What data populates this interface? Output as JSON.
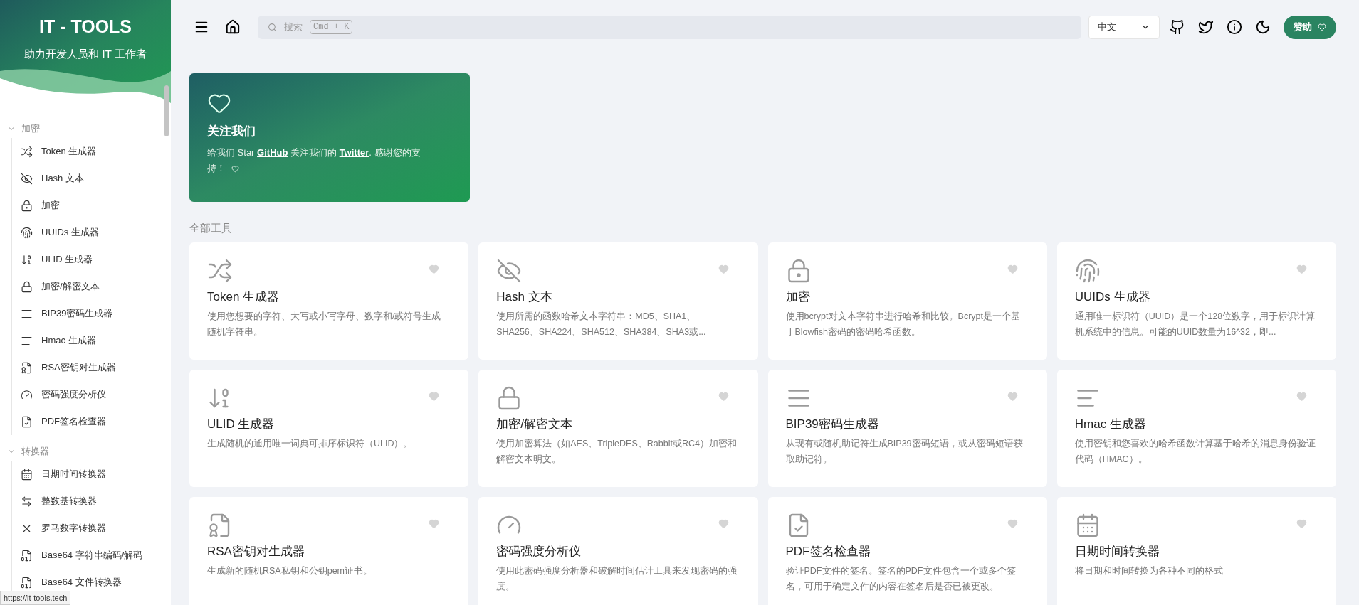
{
  "sidebar": {
    "title": "IT - TOOLS",
    "subtitle": "助力开发人员和 IT 工作者",
    "groups": [
      {
        "label": "加密",
        "expanded": true,
        "items": [
          {
            "kind": "shuffle",
            "label": "Token 生成器"
          },
          {
            "kind": "eyeoff",
            "label": "Hash 文本"
          },
          {
            "kind": "lockbox",
            "label": "加密"
          },
          {
            "kind": "fingerprint",
            "label": "UUIDs 生成器"
          },
          {
            "kind": "sortdigits",
            "label": "ULID 生成器"
          },
          {
            "kind": "lock",
            "label": "加密/解密文本"
          },
          {
            "kind": "lines",
            "label": "BIP39密码生成器"
          },
          {
            "kind": "shortlines",
            "label": "Hmac 生成器"
          },
          {
            "kind": "certificate",
            "label": "RSA密钥对生成器"
          },
          {
            "kind": "gauge",
            "label": "密码强度分析仪"
          },
          {
            "kind": "filecheck",
            "label": "PDF签名检查器"
          }
        ]
      },
      {
        "label": "转换器",
        "expanded": true,
        "items": [
          {
            "kind": "calendar",
            "label": "日期时间转换器"
          },
          {
            "kind": "arrows",
            "label": "整数基转换器"
          },
          {
            "kind": "x",
            "label": "罗马数字转换器"
          },
          {
            "kind": "filedigit",
            "label": "Base64 字符串编码/解码"
          },
          {
            "kind": "filedigit",
            "label": "Base64 文件转换器"
          }
        ]
      }
    ]
  },
  "header": {
    "search": {
      "placeholder": "搜索",
      "shortcut": "Cmd + K"
    },
    "language": "中文",
    "sponsor": "赞助"
  },
  "promo": {
    "title": "关注我们",
    "segments": [
      {
        "kind": "text",
        "text": "给我们 Star "
      },
      {
        "kind": "link",
        "text": "GitHub"
      },
      {
        "kind": "text",
        "text": " 关注我们的 "
      },
      {
        "kind": "link",
        "text": "Twitter"
      },
      {
        "kind": "text",
        "text": ". 感谢您的支持！"
      }
    ]
  },
  "section_title": "全部工具",
  "tools": [
    {
      "kind": "shuffle",
      "title": "Token 生成器",
      "description": "使用您想要的字符、大写或小写字母、数字和/或符号生成随机字符串。",
      "favorite": false
    },
    {
      "kind": "eyeoff",
      "title": "Hash 文本",
      "description": "使用所需的函数哈希文本字符串：MD5、SHA1、SHA256、SHA224、SHA512、SHA384、SHA3或...",
      "favorite": false
    },
    {
      "kind": "lockbox",
      "title": "加密",
      "description": "使用bcrypt对文本字符串进行哈希和比较。Bcrypt是一个基于Blowfish密码的密码哈希函数。",
      "favorite": false
    },
    {
      "kind": "fingerprint",
      "title": "UUIDs 生成器",
      "description": "通用唯一标识符（UUID）是一个128位数字，用于标识计算机系统中的信息。可能的UUID数量为16^32，即...",
      "favorite": false
    },
    {
      "kind": "sortdigits",
      "title": "ULID 生成器",
      "description": "生成随机的通用唯一词典可排序标识符（ULID）。",
      "favorite": false
    },
    {
      "kind": "lock",
      "title": "加密/解密文本",
      "description": "使用加密算法（如AES、TripleDES、Rabbit或RC4）加密和解密文本明文。",
      "favorite": false
    },
    {
      "kind": "lines",
      "title": "BIP39密码生成器",
      "description": "从现有或随机助记符生成BIP39密码短语，或从密码短语获取助记符。",
      "favorite": false
    },
    {
      "kind": "shortlines",
      "title": "Hmac 生成器",
      "description": "使用密钥和您喜欢的哈希函数计算基于哈希的消息身份验证代码（HMAC）。",
      "favorite": false
    },
    {
      "kind": "certificate",
      "title": "RSA密钥对生成器",
      "description": "生成新的随机RSA私钥和公钥pem证书。",
      "favorite": false
    },
    {
      "kind": "gauge",
      "title": "密码强度分析仪",
      "description": "使用此密码强度分析器和破解时间估计工具来发现密码的强度。",
      "favorite": false
    },
    {
      "kind": "filecheck",
      "title": "PDF签名检查器",
      "description": "验证PDF文件的签名。签名的PDF文件包含一个或多个签名，可用于确定文件的内容在签名后是否已被更改。",
      "favorite": false
    },
    {
      "kind": "calendar",
      "title": "日期时间转换器",
      "description": "将日期和时间转换为各种不同的格式",
      "favorite": false
    }
  ],
  "status_url": "https://it-tools.tech"
}
